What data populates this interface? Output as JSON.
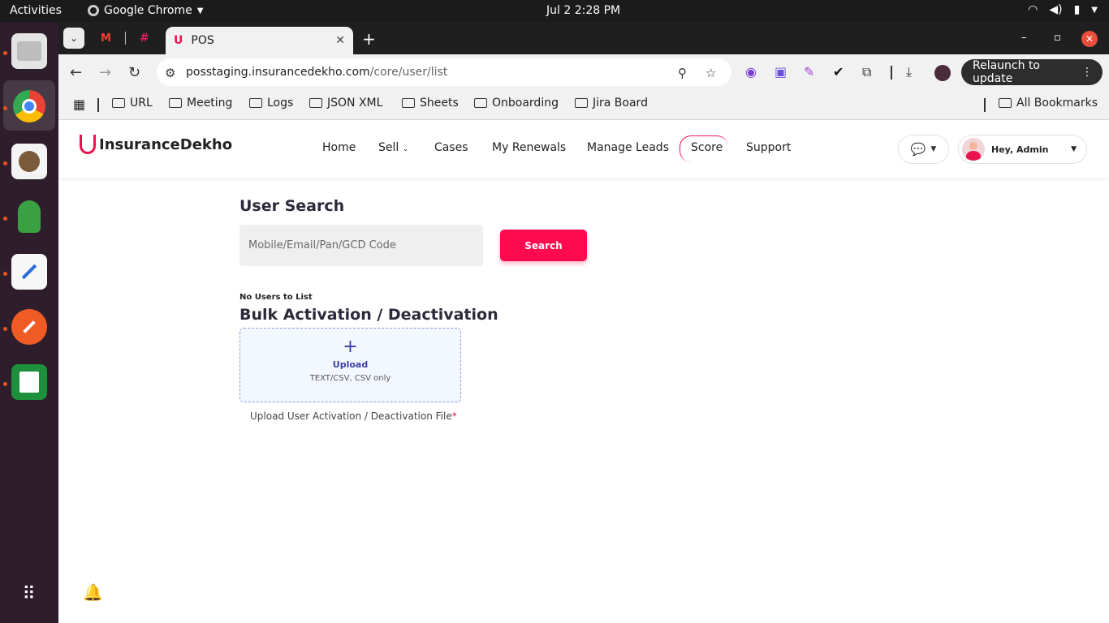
{
  "system_bar": {
    "activities": "Activities",
    "app_name": "Google Chrome",
    "clock": "Jul 2  2:28 PM"
  },
  "browser": {
    "tab_title": "POS",
    "url_host": "posstaging.insurancedekho.com",
    "url_path": "/core/user/list",
    "relaunch_label": "Relaunch to update",
    "bookmarks": [
      "URL",
      "Meeting",
      "Logs",
      "JSON XML",
      "Sheets",
      "Onboarding",
      "Jira Board"
    ],
    "all_bookmarks": "All Bookmarks"
  },
  "site": {
    "logo_text": "InsuranceDekho",
    "brand_color": "#e8134a",
    "nav": [
      "Home",
      "Sell",
      "Cases",
      "My Renewals",
      "Manage Leads",
      "Score",
      "Support"
    ],
    "user_greeting": "Hey, Admin"
  },
  "main": {
    "user_search_title": "User Search",
    "search_placeholder": "Mobile/Email/Pan/GCD Code",
    "search_button": "Search",
    "empty_state": "No Users to List",
    "bulk_title": "Bulk Activation / Deactivation",
    "upload_label": "Upload",
    "upload_hint": "TEXT/CSV, CSV only",
    "upload_caption": "Upload User Activation / Deactivation File",
    "required_marker": "*"
  }
}
